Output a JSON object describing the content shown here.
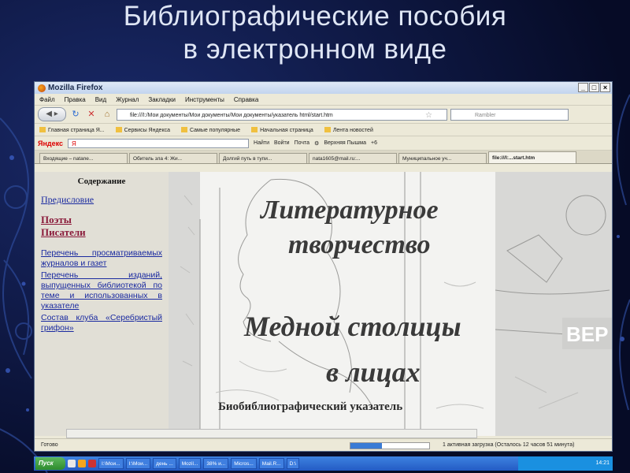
{
  "slide": {
    "title_line1": "Библиографические пособия",
    "title_line2": "в электронном виде"
  },
  "browser": {
    "window_title": "Mozilla Firefox",
    "menu": [
      "Файл",
      "Правка",
      "Вид",
      "Журнал",
      "Закладки",
      "Инструменты",
      "Справка"
    ],
    "url": "file:///I:/Мои документы/Мои документы/Мои документы/указатель html/start.htm",
    "search_placeholder": "Rambler",
    "bookmarks": [
      "Главная страница Я...",
      "Сервисы Яндекса",
      "Самые популярные",
      "Начальная страница",
      "Лента новостей"
    ],
    "yandex": {
      "logo": "Яндекс",
      "input": "Я",
      "find": "Найти",
      "login": "Войти",
      "mail": "Почта",
      "weather": "Верхняя Пышма",
      "temp": "+6"
    },
    "tabs": [
      "Входящие – natane...",
      "Обитель зла 4: Жи...",
      "Долгий путь в тупи...",
      "nata1605@mail.ru:...",
      "Муниципальное уч...",
      "file:///I:...start.htm"
    ],
    "active_tab_index": 5,
    "status_ready": "Готово",
    "status_loading": "1 активная загрузка (Осталось 12 часов 51 минута)"
  },
  "page": {
    "sidebar": {
      "heading": "Содержание",
      "preface": "Предисловие",
      "poets": "Поэты",
      "writers": "Писатели",
      "link1": "Перечень просматриваемых журналов и газет",
      "link2": "Перечень изданий, выпущенных библиотекой по теме и использованных в указателе",
      "link3": "Состав клуба «Серебристый грифон»"
    },
    "banner": {
      "line1": "Литературное",
      "line2": "творчество",
      "line3": "Медной столицы",
      "line4": "в лицах",
      "subtitle": "Биобиблиографический указатель",
      "side_text": "ВЕР"
    }
  },
  "taskbar": {
    "start": "Пуск",
    "items": [
      "I:\\Мои...",
      "I:\\Мои...",
      "день ...",
      "Mozil...",
      "38% и...",
      "Micros...",
      "Mail.R...",
      "D:\\"
    ],
    "clock": "14:21"
  }
}
